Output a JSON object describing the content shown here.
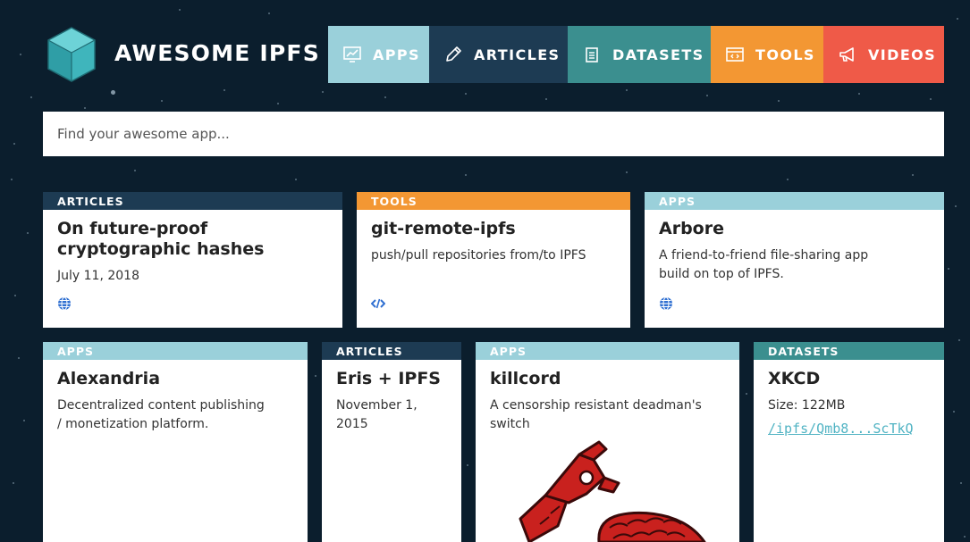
{
  "header": {
    "brand": "AWESOME IPFS"
  },
  "nav": [
    {
      "label": "APPS",
      "icon": "chart-monitor-icon",
      "color": "#9ad0da"
    },
    {
      "label": "ARTICLES",
      "icon": "pencil-icon",
      "color": "#1d3b53"
    },
    {
      "label": "DATASETS",
      "icon": "documents-icon",
      "color": "#3b8f8f"
    },
    {
      "label": "TOOLS",
      "icon": "code-window-icon",
      "color": "#f39733"
    },
    {
      "label": "VIDEOS",
      "icon": "megaphone-icon",
      "color": "#ef5a48"
    }
  ],
  "search": {
    "placeholder": "Find your awesome app..."
  },
  "cards": [
    {
      "category": "ARTICLES",
      "title": "On future-proof cryptographic hashes",
      "date": "July 11, 2018",
      "icon": "globe-icon"
    },
    {
      "category": "TOOLS",
      "title": "git-remote-ipfs",
      "description": "push/pull repositories from/to IPFS",
      "icon": "code-icon"
    },
    {
      "category": "APPS",
      "title": "Arbore",
      "description": "A friend-to-friend file-sharing app build on top of IPFS.",
      "icon": "globe-icon"
    },
    {
      "category": "APPS",
      "title": "Alexandria",
      "description": "Decentralized content publishing / monetization platform."
    },
    {
      "category": "ARTICLES",
      "title": "Eris + IPFS",
      "date": "November 1, 2015"
    },
    {
      "category": "APPS",
      "title": "killcord",
      "description": "A censorship resistant deadman's switch",
      "image": "red-cord-switch-logo"
    },
    {
      "category": "DATASETS",
      "title": "XKCD",
      "size": "Size: 122MB",
      "link": "/ipfs/Qmb8...ScTkQ"
    }
  ]
}
